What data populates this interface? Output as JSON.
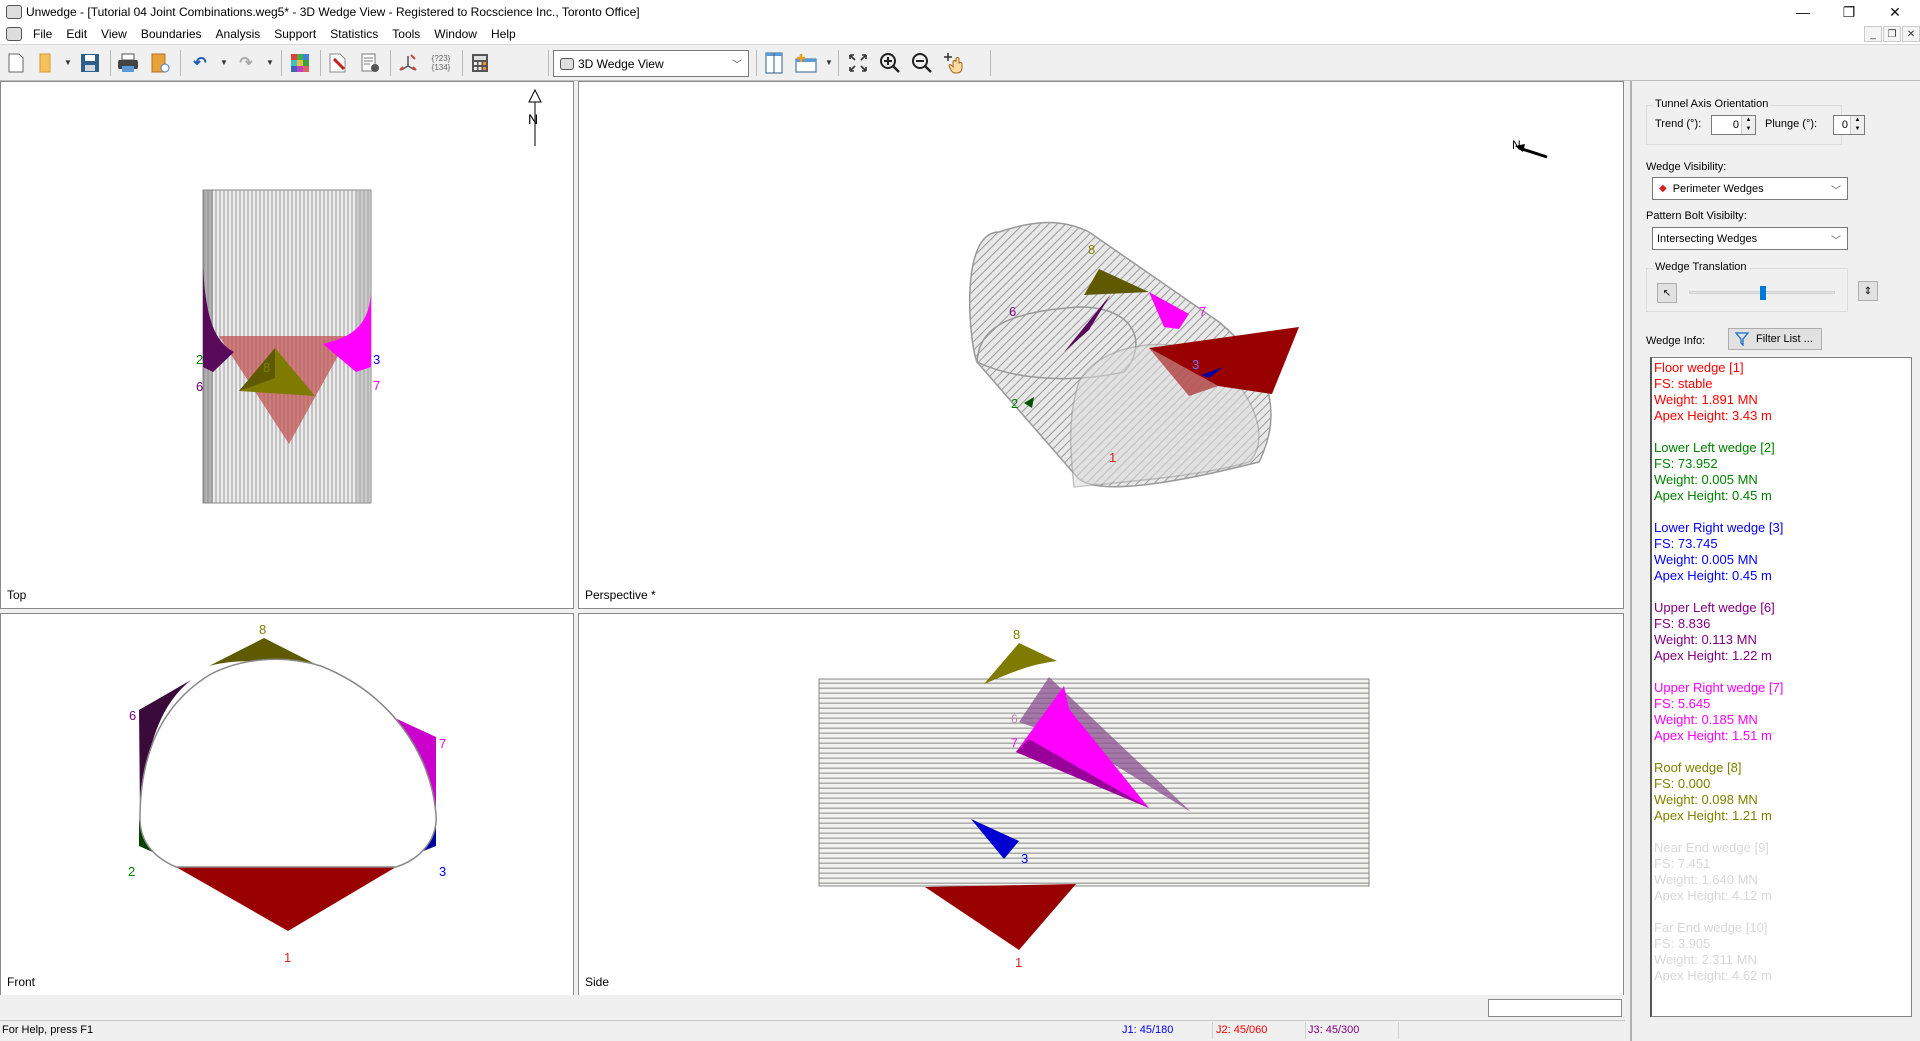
{
  "window": {
    "title": "Unwedge - [Tutorial 04 Joint Combinations.weg5* - 3D Wedge View - Registered to Rocscience Inc., Toronto Office]",
    "controls": {
      "minimize": "—",
      "restore": "❐",
      "close": "✕"
    },
    "mdi_controls": {
      "minimize": "‗",
      "restore": "❐",
      "close": "✕"
    }
  },
  "menu": [
    "File",
    "Edit",
    "View",
    "Boundaries",
    "Analysis",
    "Support",
    "Statistics",
    "Tools",
    "Window",
    "Help"
  ],
  "toolbar": {
    "icons": [
      "new-file-icon",
      "open-folder-icon",
      "save-icon",
      "print-icon",
      "export-icon",
      "undo-icon",
      "redo-icon",
      "color-grid-icon",
      "edit-icon",
      "settings-doc-icon",
      "joint-combination-icon",
      "numbering-icon",
      "calculator-icon",
      "layout-icon",
      "new-view-icon",
      "zoom-extents-icon",
      "zoom-in-icon",
      "zoom-out-icon",
      "pan-icon"
    ],
    "numbering_text": "{?23}\n{134}",
    "view_select": "3D Wedge View"
  },
  "views": {
    "top": {
      "label": "Top",
      "north": "N",
      "wedge_labels": [
        "2",
        "6",
        "8",
        "3",
        "7"
      ]
    },
    "perspective": {
      "label": "Perspective *",
      "north": "N",
      "wedge_labels": [
        "8",
        "6",
        "7",
        "2",
        "3",
        "1"
      ]
    },
    "front": {
      "label": "Front",
      "wedge_labels": [
        "8",
        "6",
        "7",
        "2",
        "3",
        "1"
      ]
    },
    "side": {
      "label": "Side",
      "wedge_labels": [
        "8",
        "6",
        "7",
        "3",
        "1"
      ]
    }
  },
  "colors": {
    "floor": "#990000",
    "lower_left": "#006400",
    "lower_right": "#0000b0",
    "upper_left": "#5a0a5a",
    "upper_right": "#ff00ff",
    "roof": "#7f7a00",
    "label_1": "#e02020",
    "label_2": "#008000",
    "label_3": "#0000ff",
    "label_6": "#800080",
    "label_7": "#ff00ff",
    "label_8": "#808000"
  },
  "panel": {
    "tunnel_axis_title": "Tunnel Axis Orientation",
    "trend_label": "Trend (°):",
    "trend_value": "0",
    "plunge_label": "Plunge (°):",
    "plunge_value": "0",
    "wedge_visibility_label": "Wedge Visibility:",
    "wedge_visibility_value": "Perimeter Wedges",
    "bolt_visibility_label": "Pattern Bolt Visibilty:",
    "bolt_visibility_value": "Intersecting Wedges",
    "translation_title": "Wedge Translation",
    "translation_value": 0.5,
    "wedge_info_label": "Wedge Info:",
    "filter_button": "Filter List ...",
    "wedges": [
      {
        "name": "Floor wedge [1]",
        "fs": "FS: stable",
        "weight": "Weight: 1.891 MN",
        "apex": "Apex Height: 3.43 m",
        "color": "#ff0000"
      },
      {
        "name": "Lower Left wedge [2]",
        "fs": "FS: 73.952",
        "weight": "Weight: 0.005 MN",
        "apex": "Apex Height: 0.45 m",
        "color": "#008000"
      },
      {
        "name": "Lower Right wedge [3]",
        "fs": "FS: 73.745",
        "weight": "Weight: 0.005 MN",
        "apex": "Apex Height: 0.45 m",
        "color": "#0000ff"
      },
      {
        "name": "Upper Left wedge [6]",
        "fs": "FS: 8.836",
        "weight": "Weight: 0.113 MN",
        "apex": "Apex Height: 1.22 m",
        "color": "#800080"
      },
      {
        "name": "Upper Right wedge [7]",
        "fs": "FS: 5.645",
        "weight": "Weight: 0.185 MN",
        "apex": "Apex Height: 1.51 m",
        "color": "#ff00ff"
      },
      {
        "name": "Roof wedge [8]",
        "fs": "FS: 0.000",
        "weight": "Weight: 0.098 MN",
        "apex": "Apex Height: 1.21 m",
        "color": "#808000"
      },
      {
        "name": "Near End wedge [9]",
        "fs": "FS: 7.451",
        "weight": "Weight: 1.640 MN",
        "apex": "Apex Height: 4.12 m",
        "color": "#d8d8d8"
      },
      {
        "name": "Far End wedge [10]",
        "fs": "FS: 3.905",
        "weight": "Weight: 2.311 MN",
        "apex": "Apex Height: 4.62 m",
        "color": "#d8d8d8"
      }
    ]
  },
  "status": {
    "help": "For Help, press F1",
    "j1": "J1: 45/180",
    "j2": "J2: 45/060",
    "j3": "J3: 45/300",
    "j1_color": "#0000ff",
    "j2_color": "#ff0000",
    "j3_color": "#800080"
  }
}
